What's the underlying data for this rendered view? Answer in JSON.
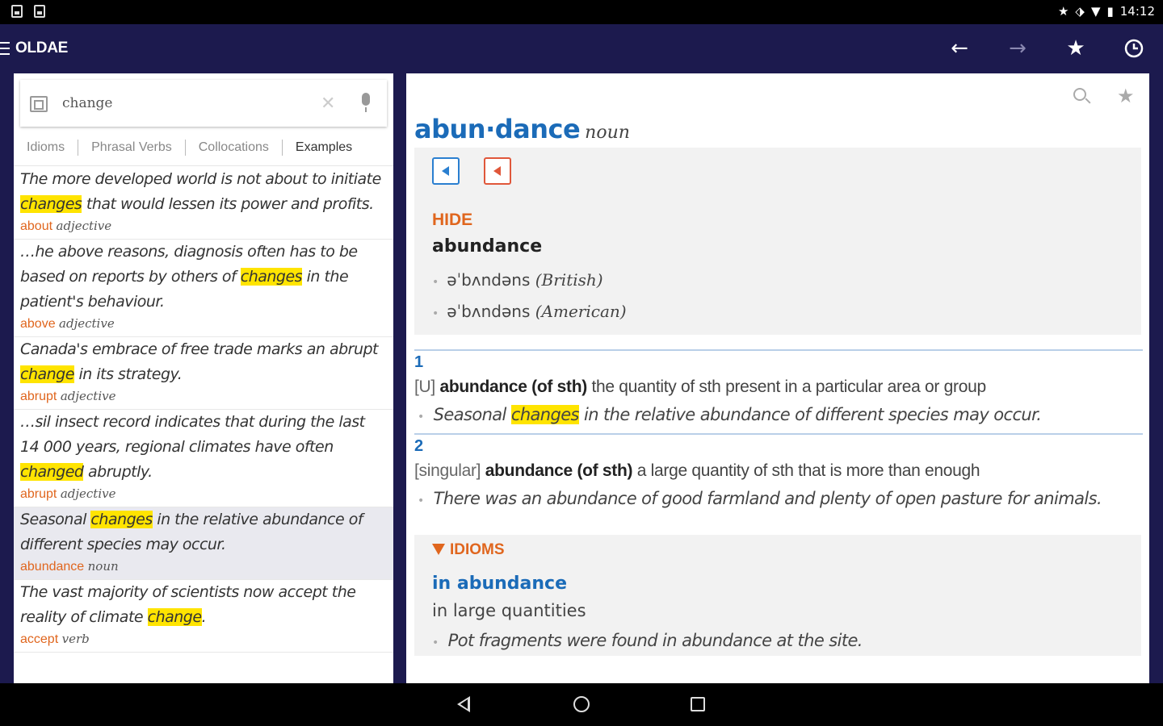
{
  "status_bar": {
    "time": "14:12",
    "icons": [
      "notification-icon",
      "notification-icon",
      "star-icon",
      "vibrate-icon",
      "wifi-icon",
      "battery-icon"
    ]
  },
  "app_bar": {
    "title": "OLDAE",
    "actions": [
      "back-arrow-icon",
      "forward-arrow-icon",
      "star-icon",
      "history-icon"
    ]
  },
  "search": {
    "value": "change",
    "placeholder": ""
  },
  "tabs": [
    {
      "label": "Idioms",
      "active": false
    },
    {
      "label": "Phrasal Verbs",
      "active": false
    },
    {
      "label": "Collocations",
      "active": false
    },
    {
      "label": "Examples",
      "active": true
    }
  ],
  "results": [
    {
      "parts": [
        "The more developed world is not about to initiate ",
        "changes",
        " that would lessen its power and profits."
      ],
      "headword": "about",
      "pos": "adjective"
    },
    {
      "parts": [
        "…he above reasons, diagnosis often has to be based on reports by others of ",
        "changes",
        " in the patient's behaviour."
      ],
      "headword": "above",
      "pos": "adjective"
    },
    {
      "parts": [
        "Canada's embrace of free trade marks an abrupt ",
        "change",
        " in its strategy."
      ],
      "headword": "abrupt",
      "pos": "adjective"
    },
    {
      "parts": [
        "…sil insect record indicates that during the last 14 000 years, regional climates have often ",
        "changed",
        " abruptly."
      ],
      "headword": "abrupt",
      "pos": "adjective"
    },
    {
      "parts": [
        "Seasonal ",
        "changes",
        " in the relative abundance of different species may occur."
      ],
      "headword": "abundance",
      "pos": "noun"
    },
    {
      "parts": [
        "The vast majority of scientists now accept the reality of climate ",
        "change",
        "."
      ],
      "headword": "accept",
      "pos": "verb"
    }
  ],
  "entry": {
    "headword": "abun·dance",
    "pos": "noun",
    "hide_label": "HIDE",
    "pron_word": "abundance",
    "pronunciations": [
      {
        "ipa": "əˈbʌndəns",
        "variety": "(British)"
      },
      {
        "ipa": "əˈbʌndəns",
        "variety": "(American)"
      }
    ],
    "senses": [
      {
        "num": "1",
        "grammar": "[U]",
        "phrase": "abundance (of sth)",
        "definition": "the quantity of sth present in a particular area or group",
        "example_parts": [
          "Seasonal ",
          "changes",
          " in the relative abundance of different species may occur."
        ]
      },
      {
        "num": "2",
        "grammar": "[singular]",
        "phrase": "abundance (of sth)",
        "definition": "a large quantity of sth that is more than enough",
        "example": "There was an abundance of good farmland and plenty of open pasture for animals."
      }
    ],
    "idioms": {
      "label": "IDIOMS",
      "phrase": "in abundance",
      "definition": "in large quantities",
      "example": "Pot fragments were found in abundance at the site."
    }
  },
  "colors": {
    "app_bar": "#1c1a4e",
    "headword_blue": "#1b6bb8",
    "accent_orange": "#e0661e",
    "highlight": "#ffe400"
  }
}
